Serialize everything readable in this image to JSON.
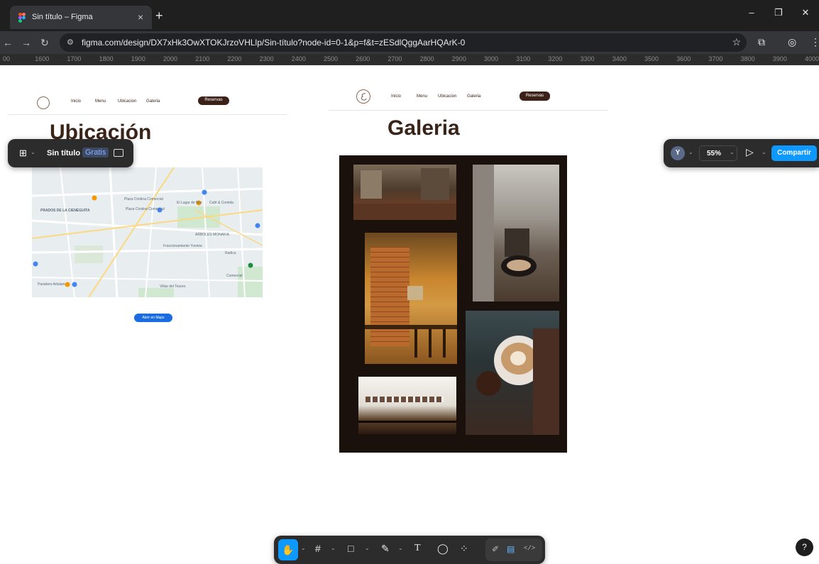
{
  "browser": {
    "tab_title": "Sin título – Figma",
    "tab_close": "×",
    "new_tab": "+",
    "url": "figma.com/design/DX7xHk3OwXTOKJrzoVHLlp/Sin-título?node-id=0-1&p=f&t=zESdlQggAarHQArK-0",
    "window_controls": [
      "–",
      "❐",
      "✕"
    ]
  },
  "ruler_marks": [
    "00",
    "1600",
    "1700",
    "1800",
    "1900",
    "2000",
    "2100",
    "2200",
    "2300",
    "2400",
    "2500",
    "2600",
    "2700",
    "2800",
    "2900",
    "3000",
    "3100",
    "3200",
    "3300",
    "3400",
    "3500",
    "3600",
    "3700",
    "3800",
    "3900",
    "4000"
  ],
  "figma": {
    "file_name": "Sin título",
    "plan_badge": "Gratis",
    "user_initial": "Y",
    "zoom": "55%",
    "share_label": "Compartir",
    "help_label": "?"
  },
  "frame1": {
    "nav": [
      "Inicio",
      "Menu",
      "Ubicacion",
      "Galeria"
    ],
    "reserve_label": "Reservas",
    "title": "Ubicación",
    "map_button": "Abrir en Maps",
    "map_labels": [
      "PRADOS DE LA CIENEGUITA",
      "Radica",
      "Plaza Cristina Comercial",
      "Plaza Cristina Comercial",
      "El Lugar de Mar",
      "Café & Comida",
      "Fraccionamiento Yvonne",
      "ARBOLES MONAKIA",
      "Villas del Tesoro",
      "Paradero Adulam",
      "Comercial"
    ]
  },
  "frame2": {
    "nav": [
      "Inicio",
      "Menu",
      "Ubicacion",
      "Galeria"
    ],
    "reserve_label": "Reservas",
    "title": "Galeria"
  },
  "colors": {
    "brand_brown": "#3a2418",
    "figma_blue": "#0d99ff",
    "maps_blue": "#1a6ce0",
    "gallery_bg": "#1a100c"
  },
  "toolbar_icons": [
    "hand-icon",
    "frame-icon",
    "rectangle-icon",
    "pen-icon",
    "text-icon",
    "comment-icon",
    "components-icon",
    "draw-icon",
    "dev-mode-icon",
    "code-icon"
  ]
}
